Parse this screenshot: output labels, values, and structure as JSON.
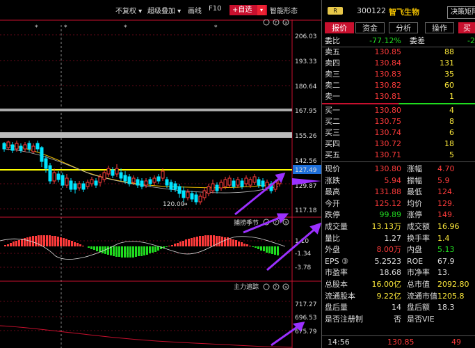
{
  "toolbar": {
    "no_adjust": "不复权",
    "super_overlay": "超级叠加",
    "draw_line": "画线",
    "f10": "F10",
    "add_watch": "+自选",
    "smart_form": "智能形态"
  },
  "chart": {
    "price_ticks": [
      "206.03",
      "193.33",
      "180.64",
      "167.95",
      "155.26",
      "142.56",
      "129.87",
      "117.18"
    ],
    "current_price_tag": "127.49",
    "low_annotation": "120.00",
    "indicator1_name": "捕捞季节",
    "indicator1_ticks": [
      "1.10",
      "-1.34",
      "-3.78"
    ],
    "indicator2_name": "主力追踪",
    "indicator2_ticks": [
      "717.27",
      "696.53",
      "675.79"
    ],
    "asterisk": "*",
    "colors": {
      "up": "#ff3b3b",
      "down": "#00e5ff",
      "ma": "#f0c000",
      "hist_down": "#1fdc1f",
      "level_line": "#ffff00",
      "arrow": "#8a2be2"
    }
  },
  "panel": {
    "badge": "R",
    "code": "300122",
    "name": "智飞生物",
    "decide_btn": "决策矩阵",
    "tabs": [
      "报价",
      "资金",
      "分析",
      "操作",
      "买"
    ],
    "weibi_label": "委比",
    "weibi_value": "-77.12%",
    "weicha_label": "委差",
    "weicha_value": "-2",
    "sell": [
      {
        "label": "卖五",
        "price": "130.85",
        "vol": "88"
      },
      {
        "label": "卖四",
        "price": "130.84",
        "vol": "131"
      },
      {
        "label": "卖三",
        "price": "130.83",
        "vol": "35"
      },
      {
        "label": "卖二",
        "price": "130.82",
        "vol": "60"
      },
      {
        "label": "卖一",
        "price": "130.81",
        "vol": "1"
      }
    ],
    "buy": [
      {
        "label": "买一",
        "price": "130.80",
        "vol": "4"
      },
      {
        "label": "买二",
        "price": "130.75",
        "vol": "8"
      },
      {
        "label": "买三",
        "price": "130.74",
        "vol": "6"
      },
      {
        "label": "买四",
        "price": "130.72",
        "vol": "18"
      },
      {
        "label": "买五",
        "price": "130.71",
        "vol": "5"
      }
    ],
    "stats": [
      {
        "l1": "现价",
        "v1": "130.80",
        "l2": "涨幅",
        "v2": "4.70"
      },
      {
        "l1": "涨跌",
        "v1": "5.94",
        "l2": "振幅",
        "v2": "5.9"
      },
      {
        "l1": "最高",
        "v1": "131.88",
        "l2": "最低",
        "v2": "124."
      },
      {
        "l1": "今开",
        "v1": "125.12",
        "l2": "均价",
        "v2": "129."
      },
      {
        "l1": "跌停",
        "v1": "99.89",
        "l2": "涨停",
        "v2": "149."
      },
      {
        "l1": "成交量",
        "v1": "13.13万",
        "l2": "成交额",
        "v2": "16.96"
      },
      {
        "l1": "量比",
        "v1": "1.27",
        "l2": "换手率",
        "v2": "1.4"
      },
      {
        "l1": "外盘",
        "v1": "8.00万",
        "l2": "内盘",
        "v2": "5.13"
      },
      {
        "l1": "EPS ③",
        "v1": "5.2523",
        "l2": "ROE",
        "v2": "67.9"
      },
      {
        "l1": "市盈率",
        "v1": "18.68",
        "l2": "市净率",
        "v2": "13."
      },
      {
        "l1": "总股本",
        "v1": "16.00亿",
        "l2": "总市值",
        "v2": "2092.80"
      },
      {
        "l1": "流通股本",
        "v1": "9.22亿",
        "l2": "流通市值",
        "v2": "1205.8"
      },
      {
        "l1": "盘后量",
        "v1": "14",
        "l2": "盘后额",
        "v2": "18.3"
      },
      {
        "l1": "是否注册制",
        "v1": "否",
        "l2": "是否VIE",
        "v2": ""
      }
    ],
    "tick_time": "14:56",
    "tick_price": "130.85",
    "tick_vol": "49"
  }
}
